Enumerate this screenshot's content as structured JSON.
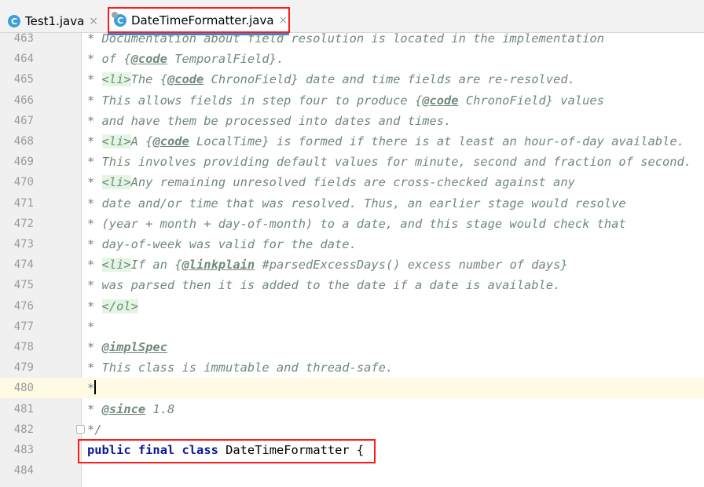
{
  "tabs": [
    {
      "label": "Test1.java",
      "icon": "java-class-icon",
      "close": "×"
    },
    {
      "label": "DateTimeFormatter.java",
      "icon": "java-class-readonly-icon",
      "close": "×",
      "active": true
    }
  ],
  "editor": {
    "current_line": "480",
    "lines": [
      {
        "num": "463",
        "text": "* Documentation about field resolution is located in the implementation"
      },
      {
        "num": "464",
        "text": "* of {@code TemporalField}."
      },
      {
        "num": "465",
        "text": "* <li>The {@code ChronoField} date and time fields are re-resolved."
      },
      {
        "num": "466",
        "text": "* This allows fields in step four to produce {@code ChronoField} values"
      },
      {
        "num": "467",
        "text": "* and have them be processed into dates and times."
      },
      {
        "num": "468",
        "text": "* <li>A {@code LocalTime} is formed if there is at least an hour-of-day available."
      },
      {
        "num": "469",
        "text": "* This involves providing default values for minute, second and fraction of second."
      },
      {
        "num": "470",
        "text": "* <li>Any remaining unresolved fields are cross-checked against any"
      },
      {
        "num": "471",
        "text": "* date and/or time that was resolved. Thus, an earlier stage would resolve"
      },
      {
        "num": "472",
        "text": "* (year + month + day-of-month) to a date, and this stage would check that"
      },
      {
        "num": "473",
        "text": "* day-of-week was valid for the date."
      },
      {
        "num": "474",
        "text": "* <li>If an {@linkplain #parsedExcessDays() excess number of days}"
      },
      {
        "num": "475",
        "text": "* was parsed then it is added to the date if a date is available."
      },
      {
        "num": "476",
        "text": "* </ol>"
      },
      {
        "num": "477",
        "text": "*"
      },
      {
        "num": "478",
        "text": "* @implSpec"
      },
      {
        "num": "479",
        "text": "* This class is immutable and thread-safe."
      },
      {
        "num": "480",
        "text": "*"
      },
      {
        "num": "481",
        "text": "* @since 1.8"
      },
      {
        "num": "482",
        "text": "*/"
      },
      {
        "num": "483",
        "text": "public final class DateTimeFormatter {"
      },
      {
        "num": "484",
        "text": ""
      }
    ]
  },
  "colors": {
    "comment": "#6f8a7a",
    "keyword": "#0c1a8f",
    "current_line": "#fefae3",
    "highlight_box": "#ff1a1a",
    "active_tab_underline": "#4083c9"
  }
}
